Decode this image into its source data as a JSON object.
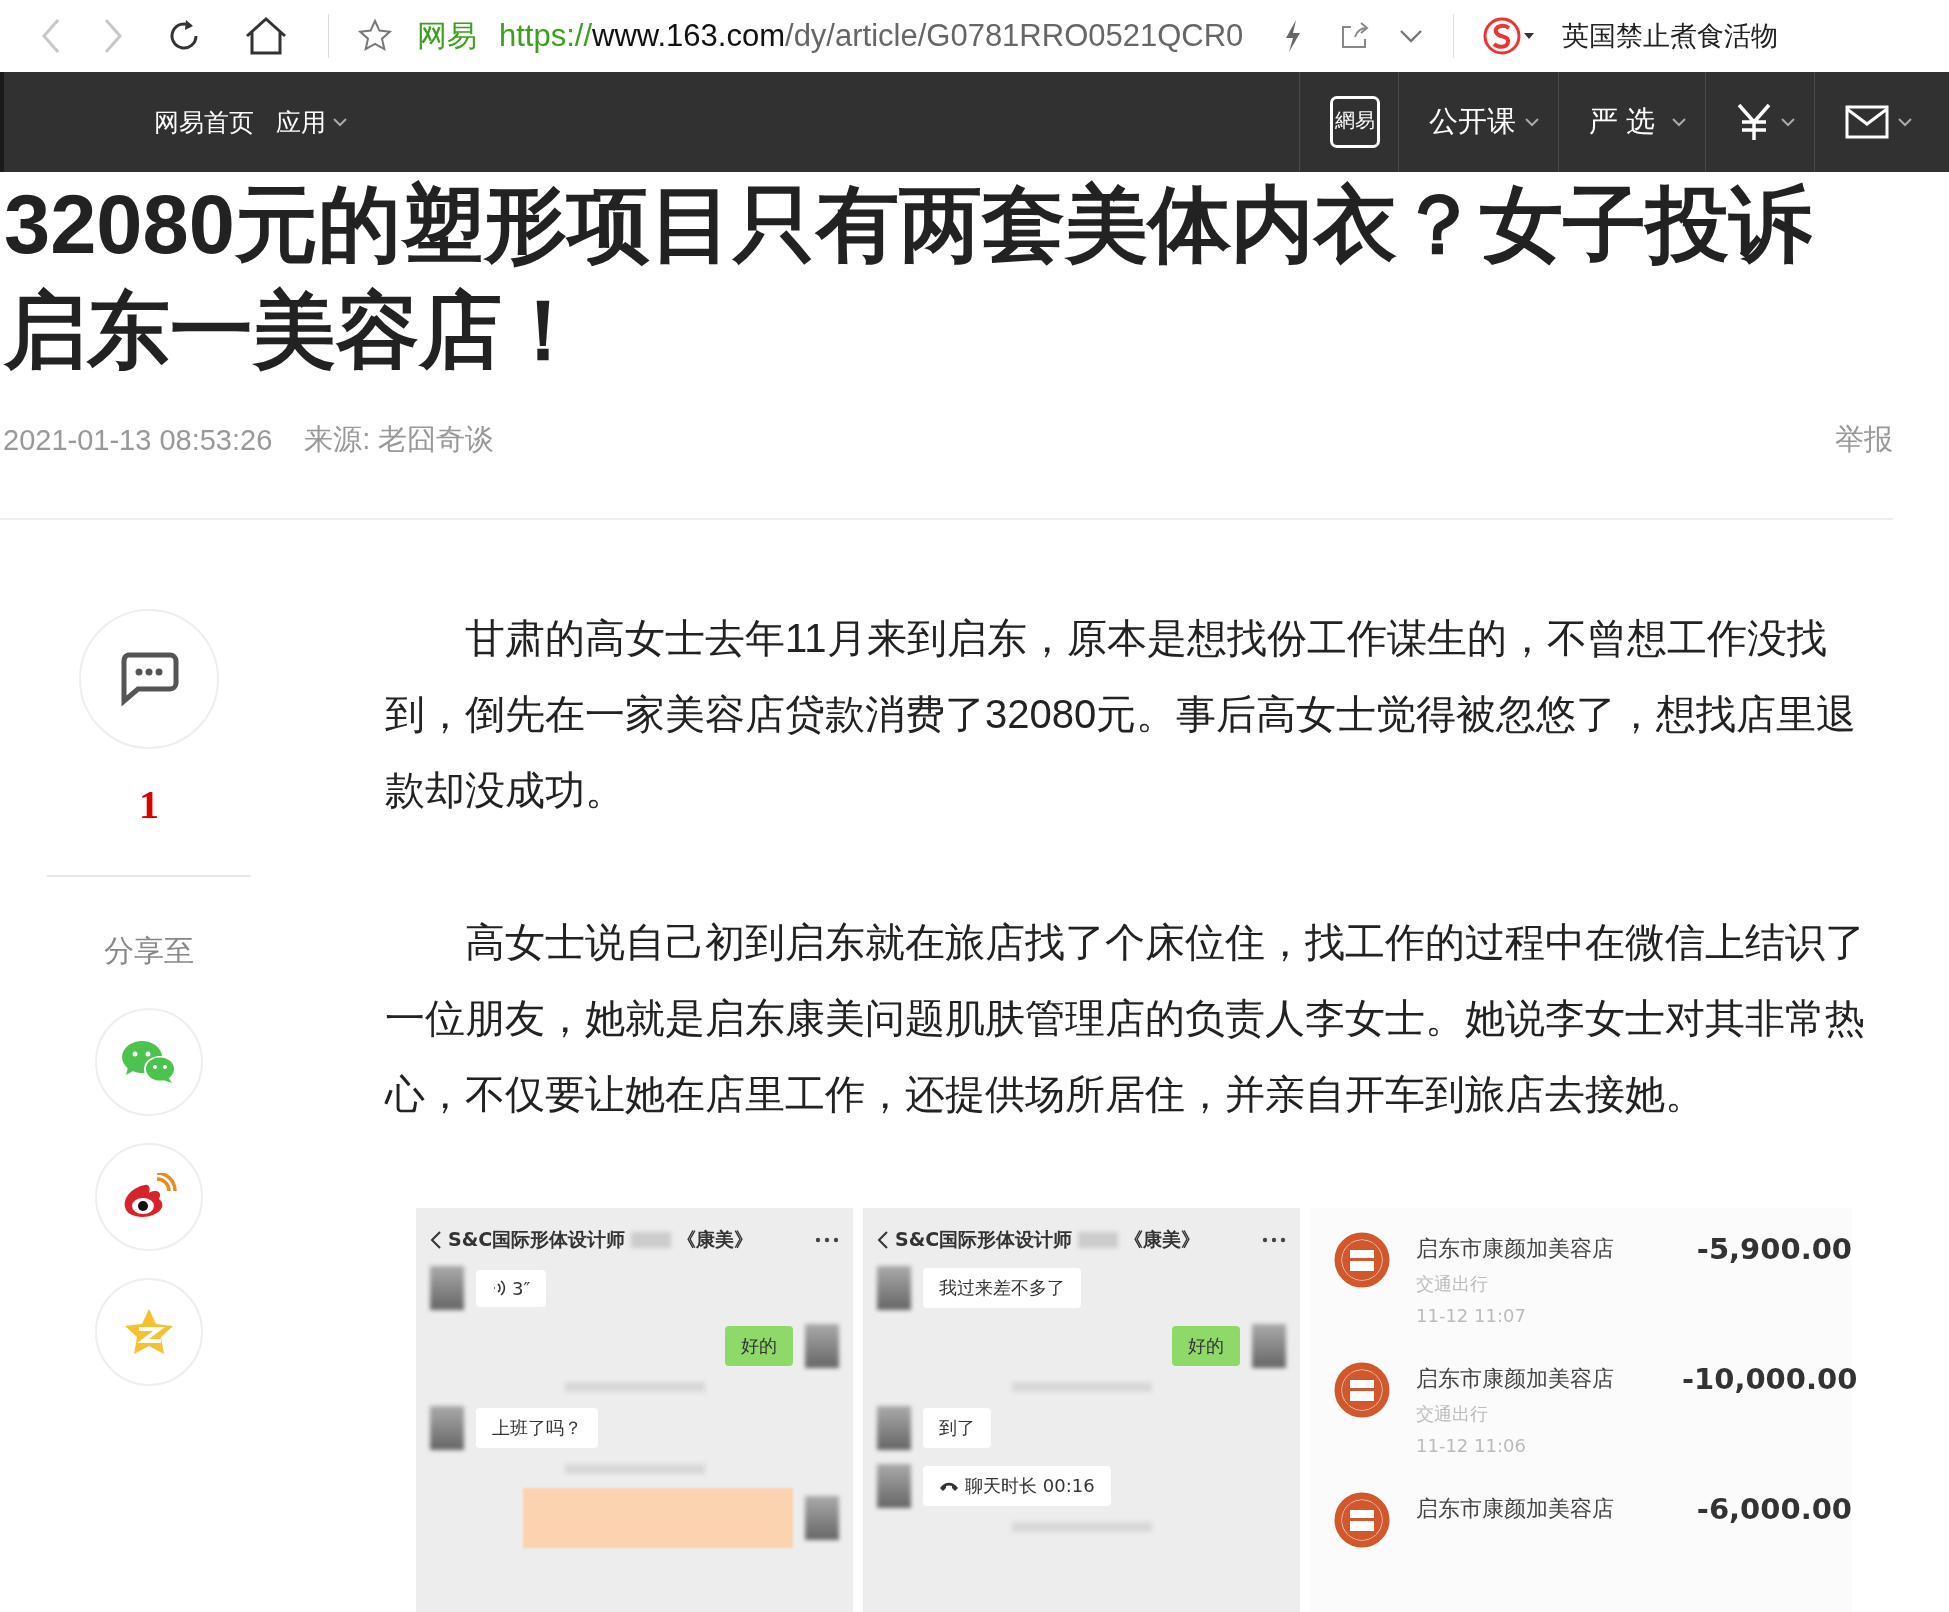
{
  "browser": {
    "site_label": "网易",
    "url": {
      "scheme": "https://",
      "host": "www.163.com",
      "path": "/dy/article/G0781RRO0521QCR0"
    },
    "search_text": "英国禁止煮食活物"
  },
  "site_nav": {
    "left": [
      {
        "label": "网易首页",
        "dropdown": false
      },
      {
        "label": "应用",
        "dropdown": true
      }
    ],
    "right": [
      {
        "kind": "logo",
        "label": "網易",
        "dropdown": false
      },
      {
        "kind": "text",
        "label": "公开课",
        "dropdown": true
      },
      {
        "kind": "text",
        "label": "严选",
        "dropdown": true
      },
      {
        "kind": "yen",
        "dropdown": true
      },
      {
        "kind": "mail",
        "dropdown": true
      }
    ]
  },
  "article": {
    "title": "32080元的塑形项目只有两套美体内衣？女子投诉启东一美容店！",
    "date": "2021-01-13 08:53:26",
    "source": "来源: 老囧奇谈",
    "report": "举报",
    "paragraphs": [
      {
        "lines": [
          "甘肃的高女士去年11月来到启东，原本是想找份工作谋生的，不曾想工作没找",
          "到，倒先在一家美容店贷款消费了32080元。事后高女士觉得被忽悠了，想找店里退",
          "款却没成功。"
        ]
      },
      {
        "lines": [
          "高女士说自己初到启东就在旅店找了个床位住，找工作的过程中在微信上结识了",
          "一位朋友，她就是启东康美问题肌肤管理店的负责人李女士。她说李女士对其非常热",
          "心，不仅要让她在店里工作，还提供场所居住，并亲自开车到旅店去接她。"
        ]
      }
    ]
  },
  "sidebar": {
    "comment_count": "1",
    "share_label": "分享至",
    "share_targets": [
      {
        "kind": "wechat"
      },
      {
        "kind": "weibo"
      },
      {
        "kind": "qzone"
      }
    ]
  },
  "image": {
    "chats": [
      {
        "title_start": "S&C国际形体设计师",
        "title_end": "《康美》",
        "messages": [
          {
            "kind": "voice",
            "outgoing": false,
            "text": "3″"
          },
          {
            "kind": "text",
            "outgoing": true,
            "text": "好的"
          },
          {
            "kind": "time"
          },
          {
            "kind": "text",
            "outgoing": false,
            "text": "上班了吗？"
          },
          {
            "kind": "time"
          },
          {
            "kind": "card",
            "outgoing": true
          }
        ]
      },
      {
        "title_start": "S&C国际形体设计师",
        "title_end": "《康美》",
        "messages": [
          {
            "kind": "text",
            "outgoing": false,
            "text": "我过来差不多了"
          },
          {
            "kind": "text",
            "outgoing": true,
            "text": "好的"
          },
          {
            "kind": "time"
          },
          {
            "kind": "text",
            "outgoing": false,
            "text": "到了"
          },
          {
            "kind": "call",
            "outgoing": false,
            "text": "聊天时长 00:16"
          },
          {
            "kind": "time"
          }
        ]
      }
    ],
    "transactions": [
      {
        "merchant": "启东市康颜加美容店",
        "category": "交通出行",
        "time": "11-12  11:07",
        "amount": "-5,900.00"
      },
      {
        "merchant": "启东市康颜加美容店",
        "category": "交通出行",
        "time": "11-12  11:06",
        "amount": "-10,000.00"
      },
      {
        "merchant": "启东市康颜加美容店",
        "amount": "-6,000.00"
      }
    ]
  }
}
